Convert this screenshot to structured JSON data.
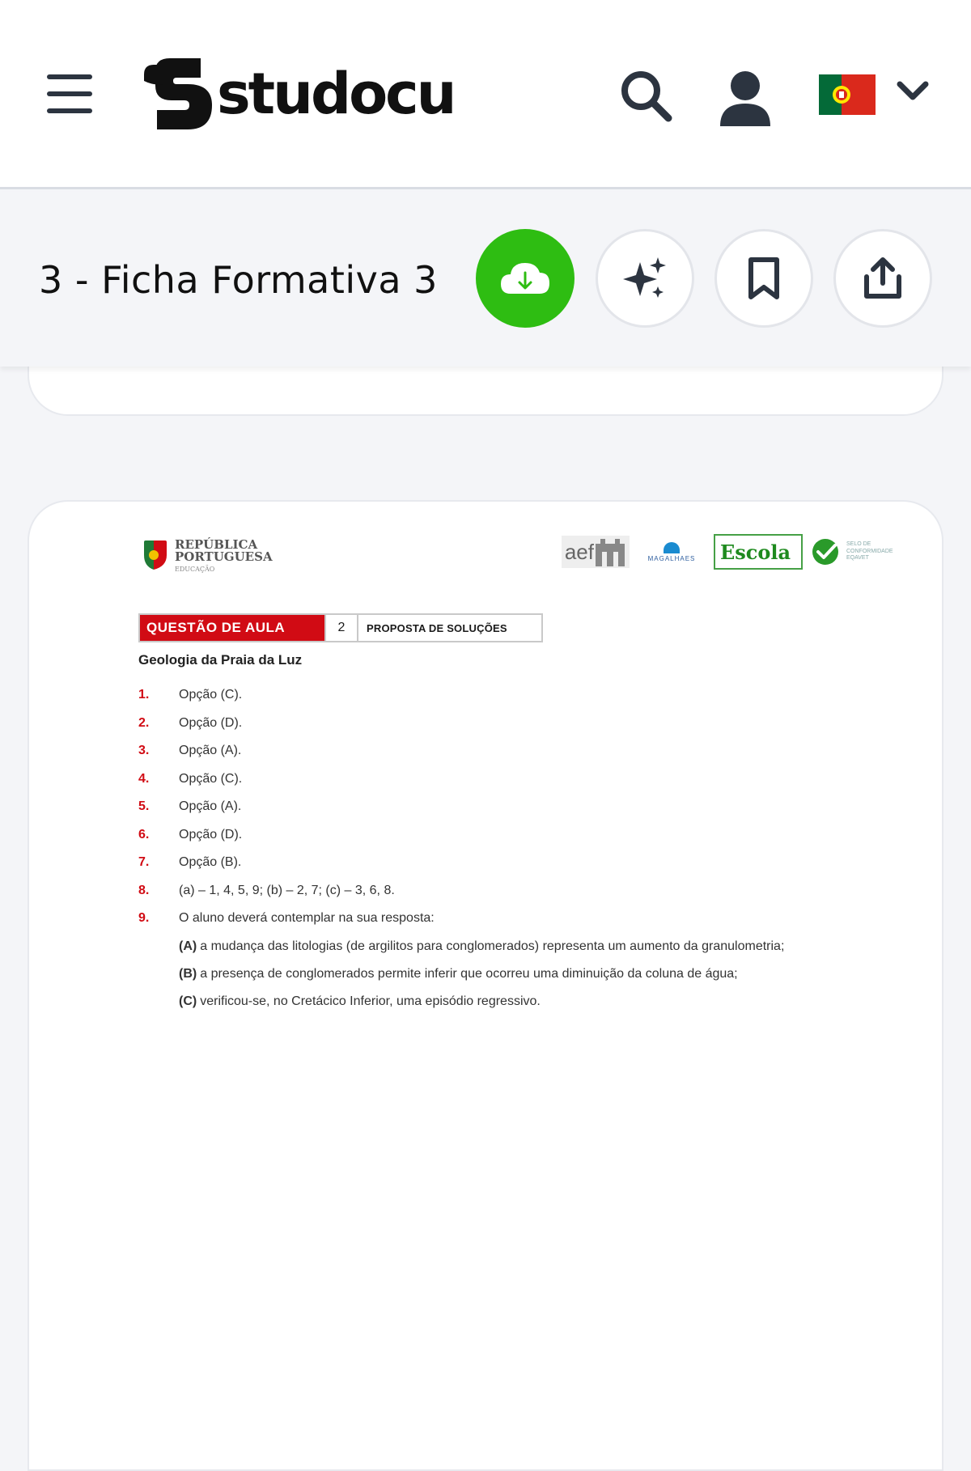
{
  "header": {
    "brand": "studocu",
    "icons": {
      "menu": "hamburger-menu-icon",
      "search": "search-icon",
      "account": "user-icon",
      "language": "portugal-flag-icon",
      "language_dropdown": "chevron-down-icon"
    }
  },
  "document": {
    "title": "3 - Ficha Formativa 3",
    "actions": {
      "download": "cloud-download-icon",
      "ai": "sparkles-icon",
      "save": "bookmark-icon",
      "share": "share-icon"
    }
  },
  "page": {
    "logos": {
      "republica_line1": "REPÚBLICA",
      "republica_line2": "PORTUGUESA",
      "republica_line3": "EDUCAÇÃO",
      "aef": "aef",
      "magalhaes": "MAGALHAES",
      "escola": "Escola",
      "equavet": "SELO DE CONFORMIDADE EQAVET"
    },
    "question_box": {
      "label": "QUESTÃO DE AULA",
      "number": "2",
      "proposal": "PROPOSTA DE SOLUÇÕES"
    },
    "subtitle": "Geologia da Praia da Luz",
    "answers": [
      {
        "n": "1.",
        "text": "Opção (C)."
      },
      {
        "n": "2.",
        "text": "Opção (D)."
      },
      {
        "n": "3.",
        "text": "Opção (A)."
      },
      {
        "n": "4.",
        "text": "Opção (C)."
      },
      {
        "n": "5.",
        "text": "Opção (A)."
      },
      {
        "n": "6.",
        "text": "Opção (D)."
      },
      {
        "n": "7.",
        "text": "Opção (B)."
      },
      {
        "n": "8.",
        "text": "(a) – 1, 4, 5, 9; (b) – 2, 7; (c) – 3, 6, 8."
      },
      {
        "n": "9.",
        "text": "O aluno deverá contemplar na sua resposta:"
      }
    ],
    "sub_points": [
      {
        "label": "(A)",
        "text": "a mudança das litologias (de argilitos para conglomerados) representa um aumento da granulometria;"
      },
      {
        "label": "(B)",
        "text": "a presença de conglomerados permite inferir que ocorreu uma diminuição da coluna de água;"
      },
      {
        "label": "(C)",
        "text": "verificou-se, no Cretácico Inferior, uma episódio regressivo."
      }
    ]
  },
  "colors": {
    "accent_green": "#2ebd12",
    "accent_red": "#d10b14",
    "background": "#f4f5f8"
  }
}
